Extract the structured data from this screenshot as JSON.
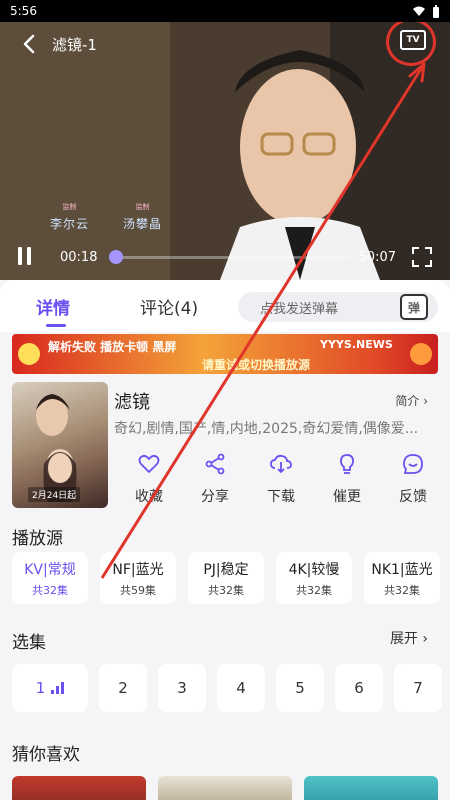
{
  "status_bar": {
    "time": "5:56"
  },
  "player": {
    "title": "滤镜-1",
    "tv_label": "TV",
    "credits": [
      {
        "role": "监制",
        "name": "李尔云"
      },
      {
        "role": "监制",
        "name": "汤攀晶"
      }
    ],
    "current_time": "00:18",
    "total_time": "50:07",
    "progress": 0.006
  },
  "tabs": {
    "detail": "详情",
    "comments": "评论(4)"
  },
  "danmu": {
    "placeholder": "点我发送弹幕",
    "icon_label": "弹"
  },
  "banner": {
    "line1": "解析失败  播放卡顿  黑屏",
    "line2": "请重试或切换播放源",
    "brand": "YYYS.NEWS"
  },
  "show": {
    "title": "滤镜",
    "intro_label": "简介",
    "tags": "奇幻,剧情,国产,情,内地,2025,奇幻爱情,偶像爱...",
    "poster_date": "2月24日起"
  },
  "actions": [
    {
      "label": "收藏",
      "icon": "heart-icon"
    },
    {
      "label": "分享",
      "icon": "share-icon"
    },
    {
      "label": "下载",
      "icon": "download-icon"
    },
    {
      "label": "催更",
      "icon": "bulb-icon"
    },
    {
      "label": "反馈",
      "icon": "smile-icon"
    }
  ],
  "sources_title": "播放源",
  "sources": [
    {
      "name": "KV|常规",
      "count": "共32集"
    },
    {
      "name": "NF|蓝光",
      "count": "共59集"
    },
    {
      "name": "PJ|稳定",
      "count": "共32集"
    },
    {
      "name": "4K|较慢",
      "count": "共32集"
    },
    {
      "name": "NK1|蓝光",
      "count": "共32集"
    }
  ],
  "episodes_title": "选集",
  "expand_label": "展开",
  "episodes": [
    "1",
    "2",
    "3",
    "4",
    "5",
    "6",
    "7"
  ],
  "recommend_title": "猜你喜欢",
  "colors": {
    "accent": "#6b4ff0",
    "annotation_red": "#e0352b"
  }
}
